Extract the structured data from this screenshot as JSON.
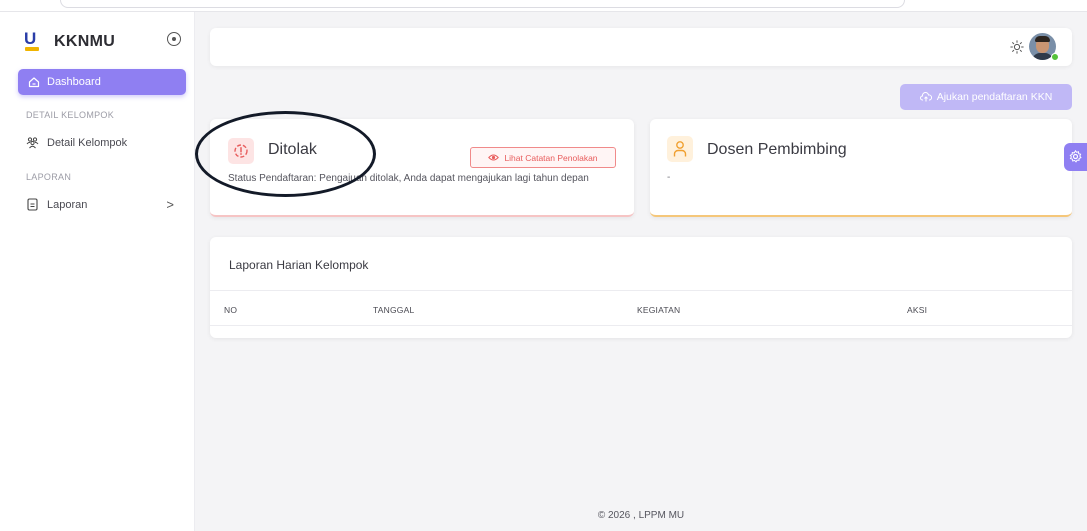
{
  "app": {
    "name": "KKNMU"
  },
  "sidebar": {
    "dashboard_label": "Dashboard",
    "section_detail": "DETAIL KELOMPOK",
    "detail_kelompok_label": "Detail Kelompok",
    "section_laporan": "LAPORAN",
    "laporan_label": "Laporan",
    "laporan_chevron": ">"
  },
  "header": {
    "apply_button_label": "Ajukan pendaftaran KKN"
  },
  "status_card": {
    "title": "Ditolak",
    "reject_notes_button": "Lihat Catatan Penolakan",
    "text": "Status Pendaftaran: Pengajuan ditolak, Anda dapat mengajukan lagi tahun depan"
  },
  "dosen_card": {
    "title": "Dosen Pembimbing",
    "value": "-"
  },
  "report_table": {
    "title": "Laporan Harian Kelompok",
    "columns": [
      "NO",
      "TANGGAL",
      "KEGIATAN",
      "AKSI"
    ]
  },
  "footer": {
    "text": "© 2026 , LPPM MU"
  },
  "colors": {
    "primary": "#8f7ff2",
    "danger": "#e85c5c",
    "warning": "#f5c77a",
    "online": "#55c23a"
  },
  "icons": {
    "brand": "university-logo-icon",
    "collapse": "radio-circle-icon",
    "dashboard": "home-icon",
    "detail_kelompok": "group-icon",
    "laporan": "document-icon",
    "theme": "sun-icon",
    "apply": "cloud-upload-icon",
    "status": "alert-circle-icon",
    "reject_notes": "eye-icon",
    "dosen": "user-icon",
    "settings": "gear-icon"
  }
}
